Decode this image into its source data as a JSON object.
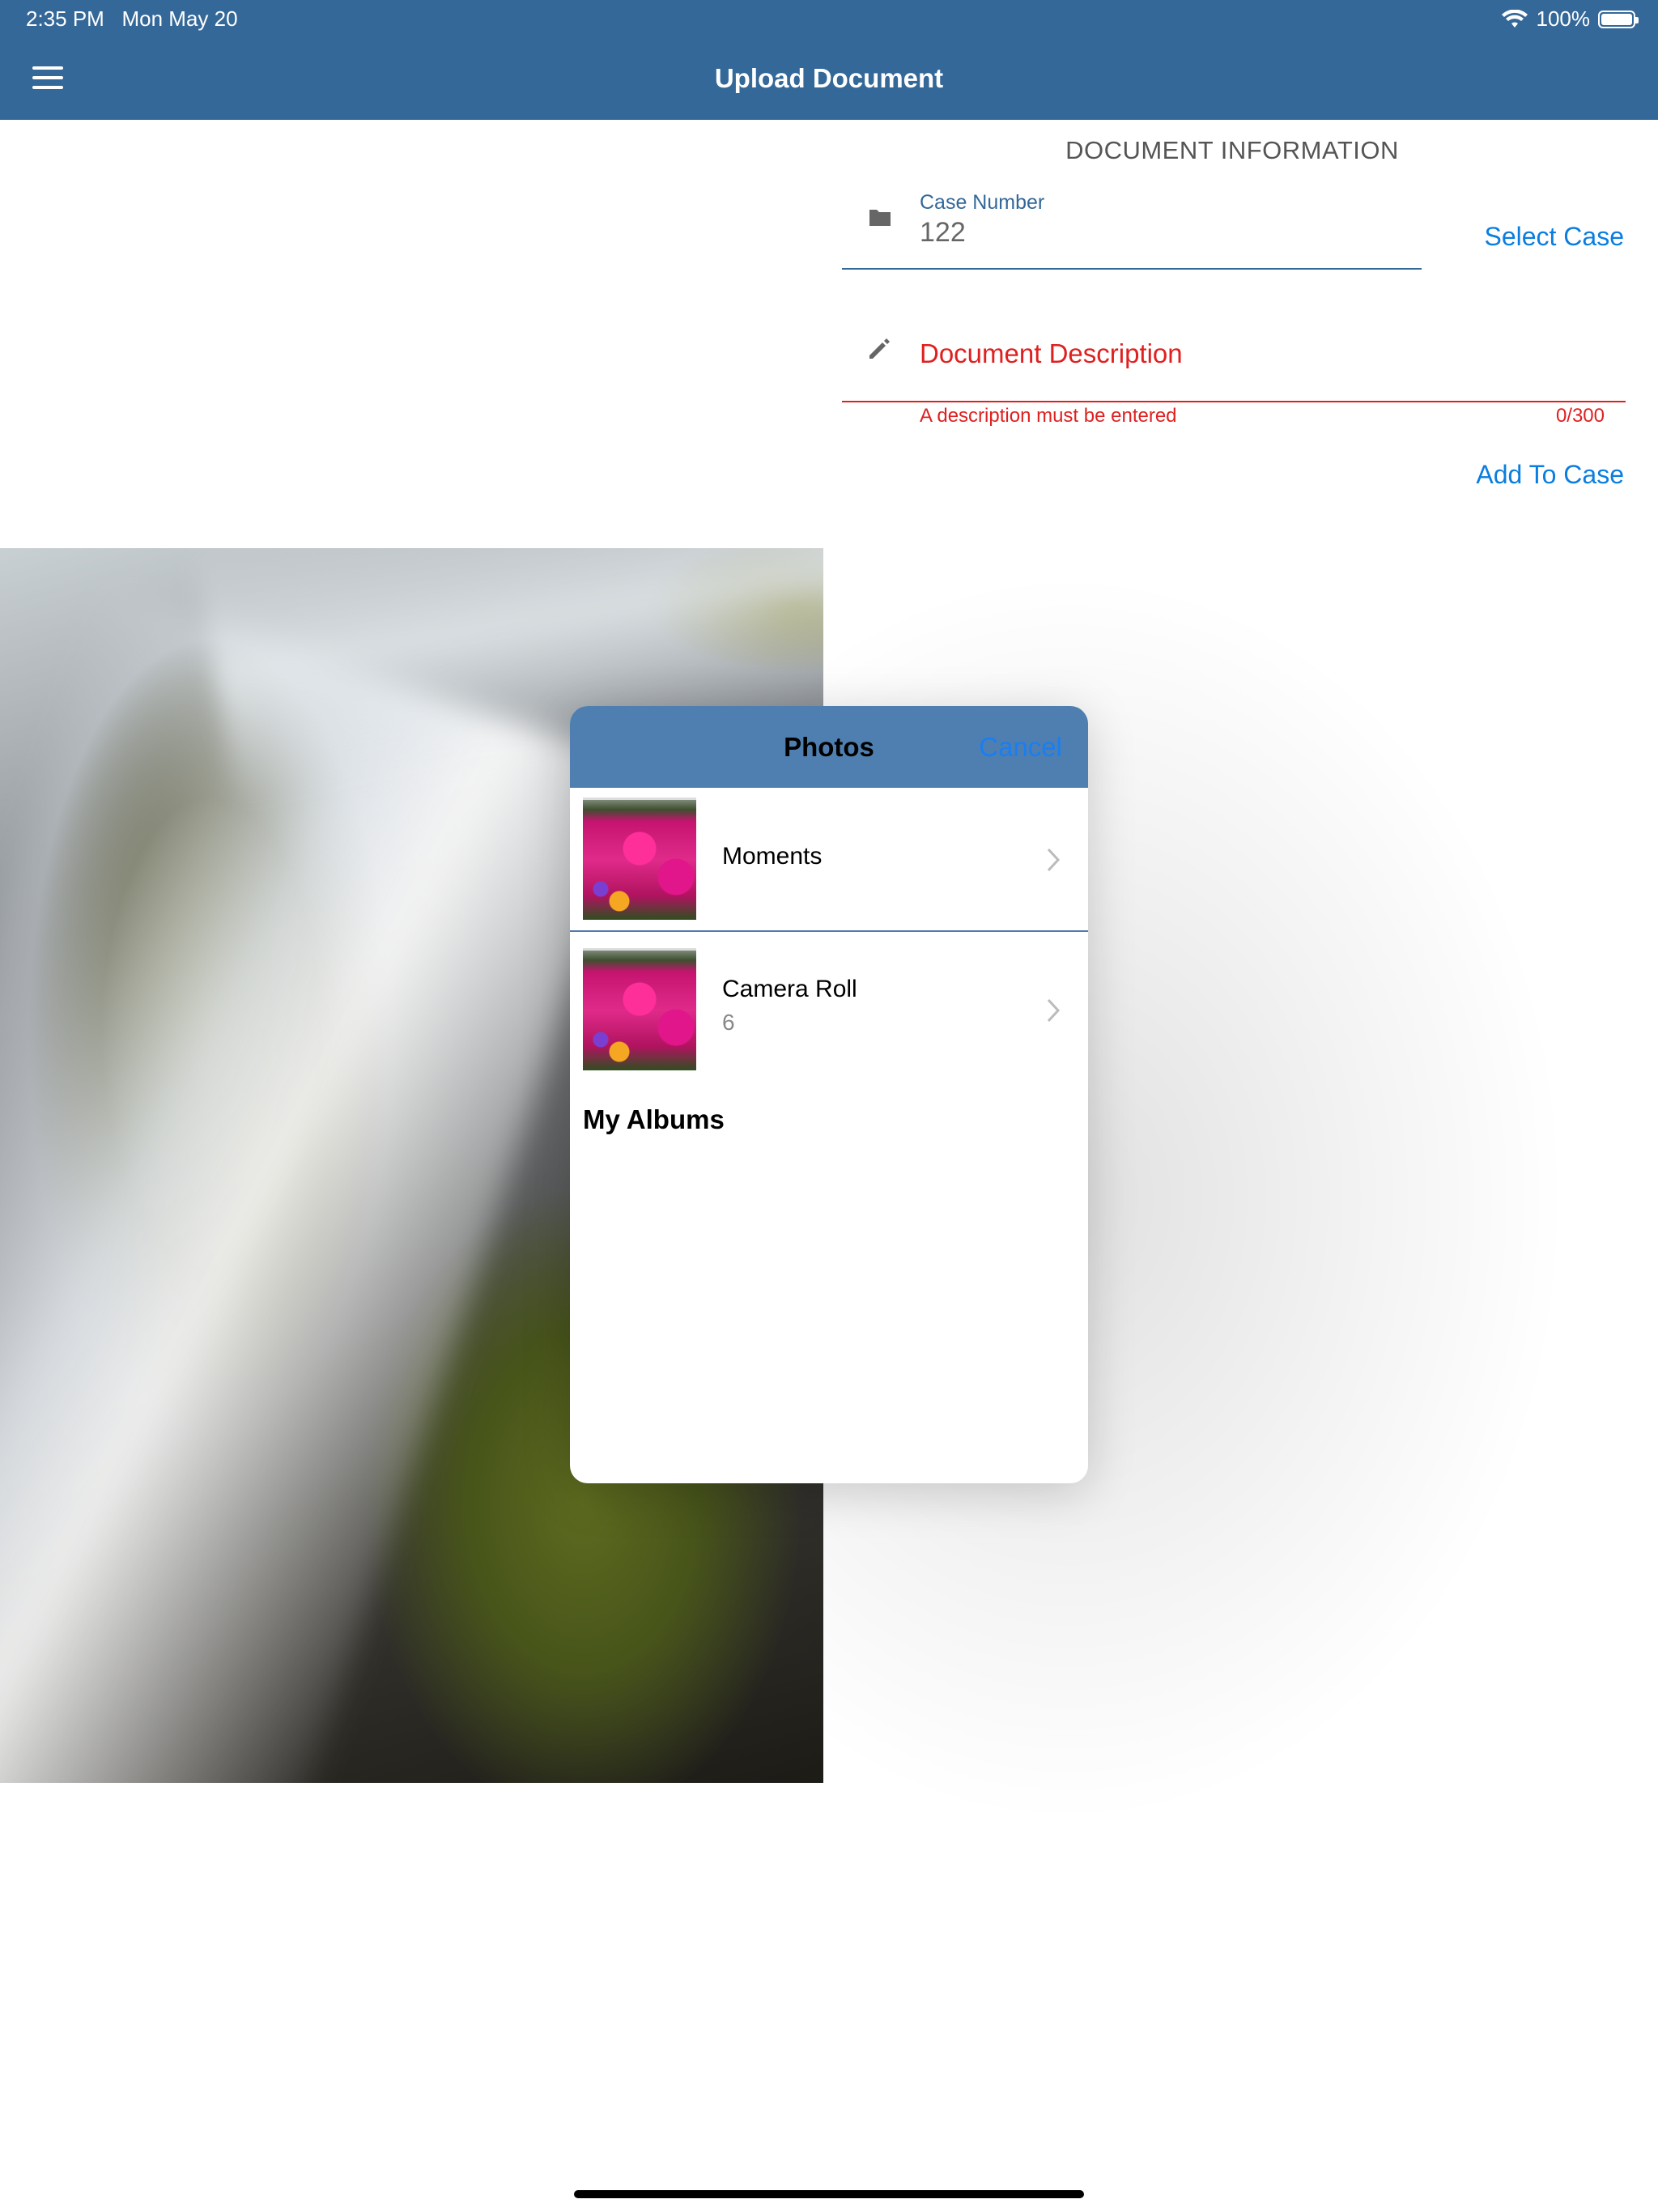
{
  "status_bar": {
    "time": "2:35 PM",
    "date": "Mon May 20",
    "battery": "100%"
  },
  "nav": {
    "title": "Upload Document"
  },
  "form": {
    "section_title": "DOCUMENT INFORMATION",
    "case_number_label": "Case Number",
    "case_number_value": "122",
    "select_case_label": "Select Case",
    "description_placeholder": "Document Description",
    "description_error": "A description must be entered",
    "description_counter": "0/300",
    "add_to_case_label": "Add To Case"
  },
  "photos_popover": {
    "title": "Photos",
    "cancel_label": "Cancel",
    "albums": [
      {
        "name": "Moments",
        "count": ""
      },
      {
        "name": "Camera Roll",
        "count": "6"
      }
    ],
    "my_albums_heading": "My Albums"
  },
  "colors": {
    "nav_bar": "#346899",
    "accent_blue": "#0a7ee0",
    "error_red": "#e02020",
    "popover_header": "#4f7fb0"
  }
}
